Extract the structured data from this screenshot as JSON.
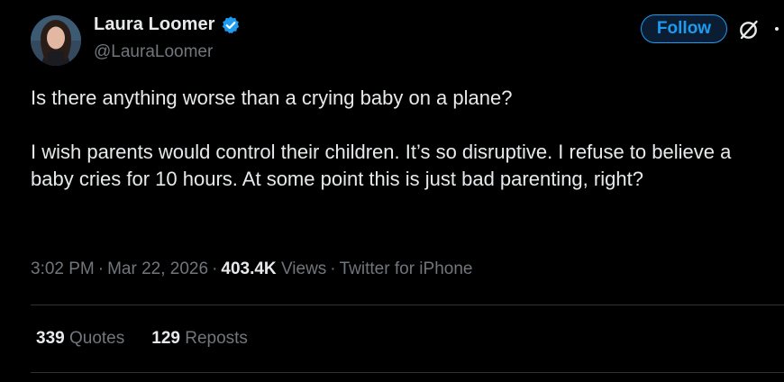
{
  "author": {
    "display_name": "Laura Loomer",
    "handle": "@LauraLoomer",
    "verified": true,
    "verified_color": "#1d9bf0"
  },
  "actions": {
    "follow_label": "Follow"
  },
  "icons": {
    "verified": "verified-badge-icon",
    "grok": "grok-icon",
    "more": "more-icon"
  },
  "tweet": {
    "paragraph_1": "Is there anything worse than a crying baby on a plane?",
    "paragraph_2": "I wish parents would control their children. It’s so disruptive. I refuse to believe a baby cries for 10 hours. At some point this is just bad parenting, right?"
  },
  "meta": {
    "time": "3:02 PM",
    "date": "Mar 22, 2026",
    "views_count": "403.4K",
    "views_label": "Views",
    "source": "Twitter for iPhone",
    "separator": "·"
  },
  "stats": {
    "quotes_count": "339",
    "quotes_label": "Quotes",
    "reposts_count": "129",
    "reposts_label": "Reposts"
  },
  "colors": {
    "background": "#000000",
    "primary_text": "#e7e9ea",
    "secondary_text": "#71767b",
    "accent": "#1d9bf0",
    "divider": "#2f3336"
  }
}
